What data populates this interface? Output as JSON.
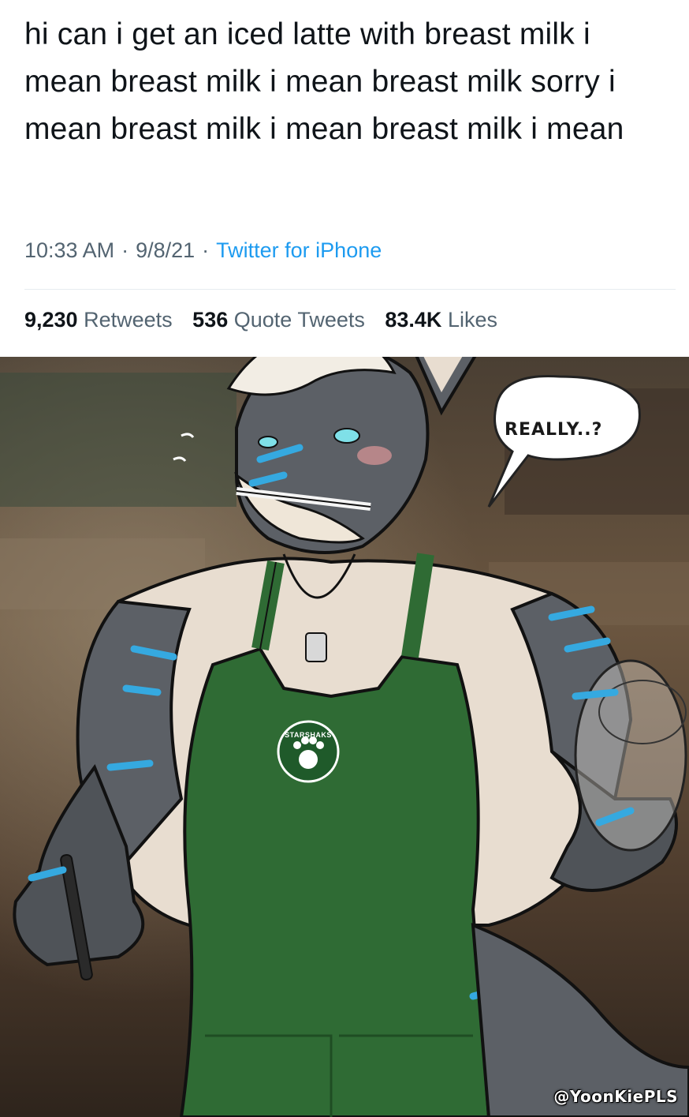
{
  "tweet": {
    "text": "hi can i get an iced latte with breast milk i mean breast milk i mean breast milk sorry i mean breast milk i mean breast milk i mean",
    "time": "10:33 AM",
    "date": "9/8/21",
    "source": "Twitter for iPhone",
    "separator": "·"
  },
  "stats": {
    "retweets_count": "9,230",
    "retweets_label": "Retweets",
    "quotes_count": "536",
    "quotes_label": "Quote Tweets",
    "likes_count": "83.4K",
    "likes_label": "Likes"
  },
  "artwork": {
    "speech_bubble": "REALLY..?",
    "apron_logo": "STARSHAKS",
    "credit": "@YoonKiePLS"
  },
  "colors": {
    "link": "#1d9bf0",
    "meta_gray": "#536471",
    "text": "#0f1419",
    "apron_green": "#2f6b34",
    "stripe_blue": "#35a9e0"
  }
}
